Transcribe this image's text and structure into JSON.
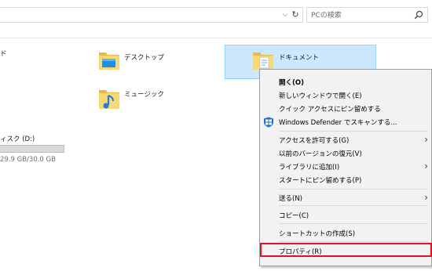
{
  "addressbar": {
    "chevron": "⌵",
    "refresh": "↻"
  },
  "search": {
    "placeholder": "PCの検索",
    "icon": "search-icon"
  },
  "left": {
    "cut_text": "ド",
    "drive_label": "ィスク (D:)",
    "drive_size": "29.9 GB/30.0 GB",
    "drive_used_fraction": 0.997
  },
  "folders": [
    {
      "label": "デスクトップ",
      "icon": "desktop-folder-icon"
    },
    {
      "label": "ドキュメント",
      "icon": "documents-folder-icon"
    },
    {
      "label": "ミュージック",
      "icon": "music-folder-icon"
    }
  ],
  "context_menu": {
    "items": [
      {
        "label": "開く(O)",
        "bold": true
      },
      {
        "label": "新しいウィンドウで開く(E)"
      },
      {
        "label": "クイック アクセスにピン留めする"
      },
      {
        "label": "Windows Defender でスキャンする...",
        "icon": "windows-defender-icon"
      },
      {
        "label": "アクセスを許可する(G)",
        "submenu": true
      },
      {
        "label": "以前のバージョンの復元(V)"
      },
      {
        "label": "ライブラリに追加(I)",
        "submenu": true
      },
      {
        "label": "スタートにピン留めする(P)"
      },
      {
        "label": "送る(N)",
        "submenu": true
      },
      {
        "label": "コピー(C)"
      },
      {
        "label": "ショートカットの作成(S)"
      },
      {
        "label": "プロパティ(R)",
        "highlighted": true
      }
    ]
  },
  "colors": {
    "selection": "#cce8ff",
    "highlight_border": "#e4101f",
    "menu_bg": "#f2f2f2"
  }
}
